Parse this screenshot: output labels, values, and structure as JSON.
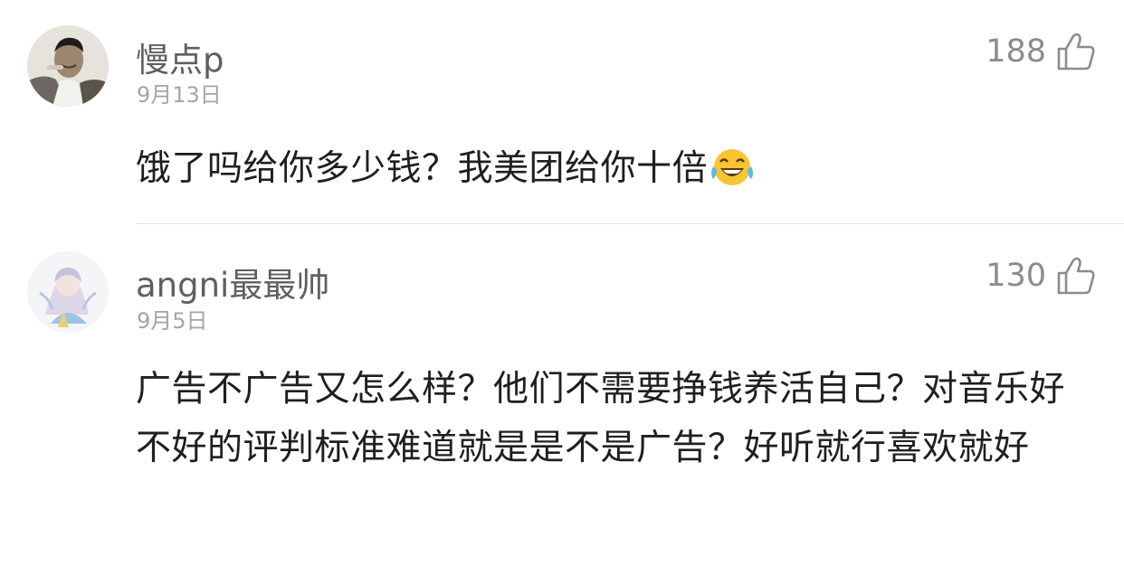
{
  "comments": [
    {
      "username": "慢点p",
      "date": "9月13日",
      "likes": "188",
      "text": "饿了吗给你多少钱？我美团给你十倍",
      "emoji": "laughing-tears-emoji"
    },
    {
      "username": "angni最最帅",
      "date": "9月5日",
      "likes": "130",
      "text": "广告不广告又怎么样？他们不需要挣钱养活自己？对音乐好不好的评判标准难道就是是不是广告？好听就行喜欢就好"
    }
  ],
  "icons": {
    "like": "thumbs-up-icon"
  },
  "colors": {
    "username": "#5f5f5f",
    "date": "#a4a4a4",
    "like_count": "#8c8c8c",
    "text": "#1f1f1f",
    "divider": "#e4e4e4"
  }
}
